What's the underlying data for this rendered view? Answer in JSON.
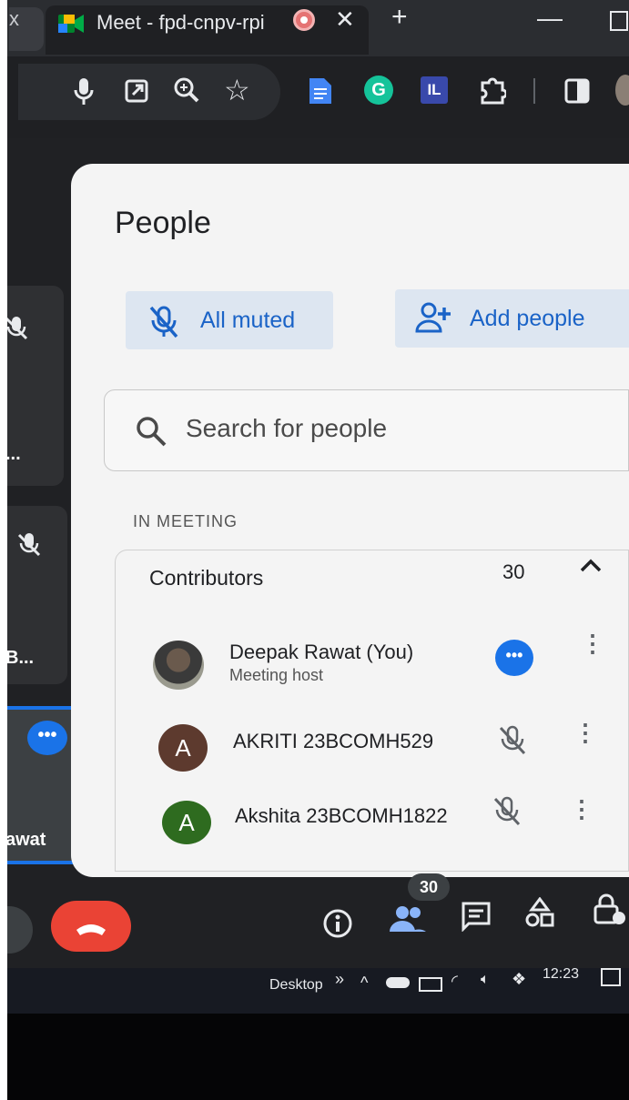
{
  "browser": {
    "prev_tab_glyph": "x",
    "tab_title": "Meet - fpd-cnpv-rpi",
    "tab_close": "✕",
    "new_tab": "+",
    "minimize": "—",
    "toolbar_icons": [
      "mic-icon",
      "open-external-icon",
      "zoom-icon",
      "star-icon",
      "docs-extension-icon",
      "grammarly-extension-icon",
      "il-extension-icon",
      "puzzle-extensions-icon",
      "side-panel-icon"
    ],
    "grammarly_letter": "G",
    "il_letters": "IL"
  },
  "meet": {
    "tile_names": {
      "tile1": "...",
      "tile2": "B...",
      "tile3": "awat"
    },
    "panel": {
      "title": "People",
      "all_muted": "All muted",
      "add_people": "Add people",
      "search_placeholder": "Search for people",
      "section": "IN MEETING",
      "group_label": "Contributors",
      "group_count": "30",
      "participants": [
        {
          "name": "Deepak Rawat (You)",
          "subtitle": "Meeting host",
          "avatar": "photo"
        },
        {
          "name": "AKRITI 23BCOMH529",
          "initial": "A",
          "color": "#5d3a2e",
          "status": "muted"
        },
        {
          "name": "Akshita 23BCOMH1822",
          "initial": "A",
          "color": "#2e6b1f",
          "status": "muted"
        }
      ]
    },
    "callbar": {
      "people_badge": "30",
      "icons": [
        "end-call-icon",
        "info-icon",
        "people-icon",
        "chat-icon",
        "activities-icon",
        "host-controls-icon"
      ]
    }
  },
  "taskbar": {
    "desktop_label": "Desktop",
    "chevrons": "»",
    "time": "12:23",
    "icons": [
      "up-arrow-icon",
      "onedrive-icon",
      "battery-icon",
      "wifi-icon",
      "volume-icon",
      "dropbox-icon",
      "notification-icon"
    ]
  },
  "colors": {
    "accent": "#1a73e8",
    "end_call": "#ea4335",
    "panel_bg": "#f4f4f4"
  }
}
